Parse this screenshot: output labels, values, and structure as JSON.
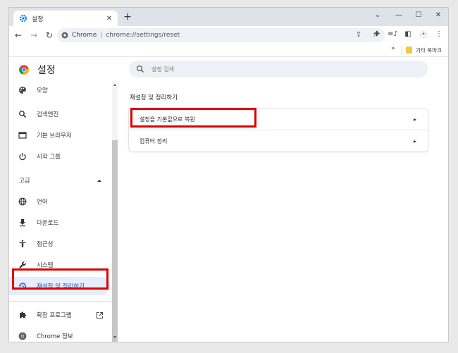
{
  "tab": {
    "title": "설정",
    "close": "✕"
  },
  "window": {
    "new_tab": "+",
    "chevron": "⌄",
    "minimize": "—",
    "maximize": "☐",
    "close": "✕"
  },
  "toolbar": {
    "back": "←",
    "forward": "→",
    "reload": "↻",
    "site": "Chrome",
    "separator": "|",
    "url": "chrome://settings/reset",
    "share": "⇪",
    "star": "☆",
    "extensions": "✚",
    "media": "≡♪",
    "sidepanel": "◧",
    "menu": "⋮"
  },
  "bookmarks": {
    "overflow": "»",
    "folder_label": "기타 북마크"
  },
  "header": {
    "title": "설정"
  },
  "search": {
    "placeholder": "설정 검색"
  },
  "sidebar": {
    "items": [
      {
        "label": "모양",
        "icon": "palette-icon"
      },
      {
        "label": "검색엔진",
        "icon": "search-icon"
      },
      {
        "label": "기본 브라우저",
        "icon": "browser-icon"
      },
      {
        "label": "시작 그룹",
        "icon": "power-icon"
      }
    ],
    "advanced": {
      "label": "고급"
    },
    "advanced_items": [
      {
        "label": "언어",
        "icon": "globe-icon"
      },
      {
        "label": "다운로드",
        "icon": "download-icon"
      },
      {
        "label": "접근성",
        "icon": "accessibility-icon"
      },
      {
        "label": "시스템",
        "icon": "wrench-icon"
      },
      {
        "label": "재설정 및 정리하기",
        "icon": "restore-icon"
      }
    ],
    "extensions": {
      "label": "확장 프로그램"
    },
    "about": {
      "label": "Chrome 정보"
    }
  },
  "main": {
    "section_title": "재설정 및 정리하기",
    "rows": [
      {
        "label": "설정을 기본값으로 복원",
        "chevron": "▸"
      },
      {
        "label": "컴퓨터 정리",
        "chevron": "▸"
      }
    ]
  },
  "colors": {
    "highlight": "#e00000",
    "accent": "#1a56b8",
    "active_bg": "#e6eefb"
  }
}
